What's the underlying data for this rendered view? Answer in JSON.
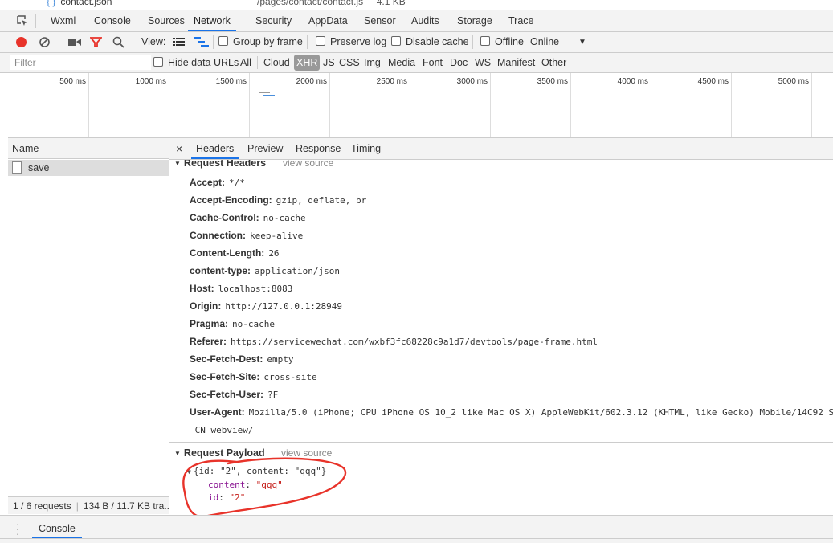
{
  "topstrip": {
    "left_file": "contact.json",
    "right_path": "/pages/contact/contact.js",
    "right_size": "4.1 KB"
  },
  "tabs": [
    "Wxml",
    "Console",
    "Sources",
    "Network",
    "Security",
    "AppData",
    "Sensor",
    "Audits",
    "Storage",
    "Trace"
  ],
  "active_tab": "Network",
  "network_toolbar": {
    "view_label": "View:",
    "group_by_frame": "Group by frame",
    "preserve_log": "Preserve log",
    "disable_cache": "Disable cache",
    "offline": "Offline",
    "throttle": "Online"
  },
  "filter_bar": {
    "placeholder": "Filter",
    "hide_data_urls": "Hide data URLs",
    "types": [
      "All",
      "Cloud",
      "XHR",
      "JS",
      "CSS",
      "Img",
      "Media",
      "Font",
      "Doc",
      "WS",
      "Manifest",
      "Other"
    ],
    "selected_type": "XHR"
  },
  "timeline_ticks": [
    "500 ms",
    "1000 ms",
    "1500 ms",
    "2000 ms",
    "2500 ms",
    "3000 ms",
    "3500 ms",
    "4000 ms",
    "4500 ms",
    "5000 ms"
  ],
  "name_column": {
    "header": "Name",
    "rows": [
      "save"
    ]
  },
  "status_summary": "1 / 6 requests",
  "status_transfer": "134 B / 11.7 KB tra...",
  "detail_tabs": [
    "Headers",
    "Preview",
    "Response",
    "Timing"
  ],
  "active_detail_tab": "Headers",
  "request_headers": {
    "title": "Request Headers",
    "view_source": "view source",
    "items": [
      {
        "key": "Accept:",
        "value": "*/*"
      },
      {
        "key": "Accept-Encoding:",
        "value": "gzip, deflate, br"
      },
      {
        "key": "Cache-Control:",
        "value": "no-cache"
      },
      {
        "key": "Connection:",
        "value": "keep-alive"
      },
      {
        "key": "Content-Length:",
        "value": "26"
      },
      {
        "key": "content-type:",
        "value": "application/json"
      },
      {
        "key": "Host:",
        "value": "localhost:8083"
      },
      {
        "key": "Origin:",
        "value": "http://127.0.0.1:28949"
      },
      {
        "key": "Pragma:",
        "value": "no-cache"
      },
      {
        "key": "Referer:",
        "value": "https://servicewechat.com/wxbf3fc68228c9a1d7/devtools/page-frame.html"
      },
      {
        "key": "Sec-Fetch-Dest:",
        "value": "empty"
      },
      {
        "key": "Sec-Fetch-Site:",
        "value": "cross-site"
      },
      {
        "key": "Sec-Fetch-User:",
        "value": "?F"
      },
      {
        "key": "User-Agent:",
        "value": "Mozilla/5.0 (iPhone; CPU iPhone OS 10_2 like Mac OS X) AppleWebKit/602.3.12 (KHTML, like Gecko) Mobile/14C92 Sa"
      }
    ],
    "user_agent_wrap": "_CN webview/"
  },
  "request_payload": {
    "title": "Request Payload",
    "view_source": "view source",
    "summary": "{id: \"2\", content: \"qqq\"}",
    "props": [
      {
        "key": "content",
        "value": "\"qqq\""
      },
      {
        "key": "id",
        "value": "\"2\""
      }
    ]
  },
  "drawer": {
    "tab": "Console"
  },
  "colors": {
    "accent": "#1a73e8",
    "record_red": "#e8332a",
    "annotation_red": "#e8332a"
  }
}
